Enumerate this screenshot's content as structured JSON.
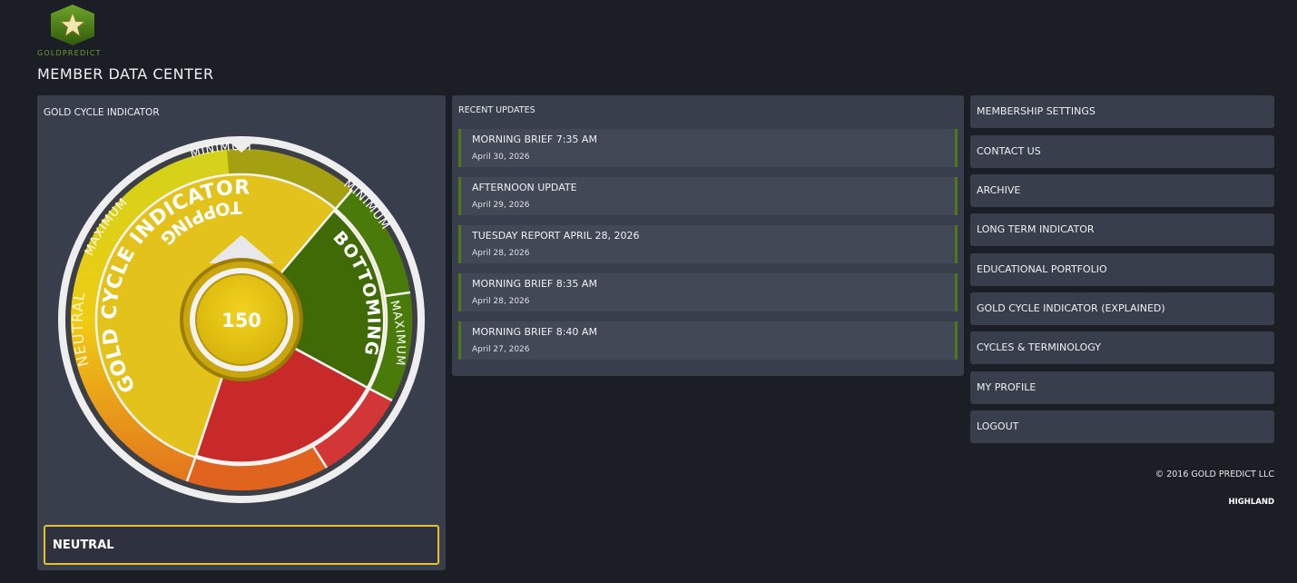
{
  "brand": {
    "logo_text": "GOLDPREDICT"
  },
  "page": {
    "title": "MEMBER DATA CENTER"
  },
  "gold_cycle": {
    "panel_title": "GOLD CYCLE INDICATOR",
    "value": "150",
    "status": "NEUTRAL",
    "wheel": {
      "center_label": "GOLD CYCLE INDICATOR",
      "outer_neutral": "NEUTRAL",
      "bottoming": "BOTTOMING",
      "topping": "TOPPING",
      "bottoming_min": "MINIMUM",
      "bottoming_max": "MAXIMUM",
      "topping_max": "MAXIMUM",
      "topping_min": "MINIMUM"
    },
    "colors": {
      "neutral": "#e4c21c",
      "bottoming": "#3f6a06",
      "topping": "#c82a2a",
      "accent": "#e6c02e"
    }
  },
  "updates": {
    "title": "RECENT UPDATES",
    "items": [
      {
        "title": "MORNING BRIEF 7:35 AM",
        "date": "April 30, 2026"
      },
      {
        "title": "AFTERNOON UPDATE",
        "date": "April 29, 2026"
      },
      {
        "title": "TUESDAY REPORT APRIL 28, 2026",
        "date": "April 28, 2026"
      },
      {
        "title": "MORNING BRIEF 8:35 AM",
        "date": "April 28, 2026"
      },
      {
        "title": "MORNING BRIEF 8:40 AM",
        "date": "April 27, 2026"
      }
    ]
  },
  "menu": {
    "items": [
      "MEMBERSHIP SETTINGS",
      "CONTACT US",
      "ARCHIVE",
      "LONG TERM INDICATOR",
      "EDUCATIONAL PORTFOLIO",
      "GOLD CYCLE INDICATOR (EXPLAINED)",
      "CYCLES & TERMINOLOGY",
      "MY PROFILE",
      "LOGOUT"
    ]
  },
  "footer": {
    "copyright": "© 2016 GOLD PREDICT LLC",
    "credit": "HIGHLAND"
  }
}
